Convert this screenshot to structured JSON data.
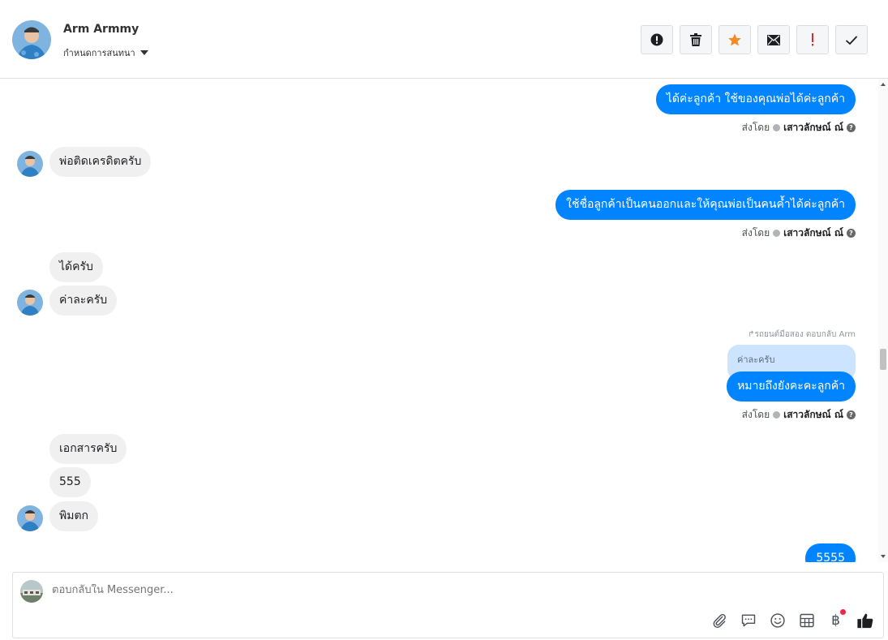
{
  "header": {
    "contact_name": "Arm Armmy",
    "subtitle": "กำหนดการสนทนา",
    "actions": [
      {
        "icon": "alert-icon",
        "name": "report-button"
      },
      {
        "icon": "trash-icon",
        "name": "delete-button"
      },
      {
        "icon": "star-icon",
        "name": "star-button",
        "color": "#f28b26"
      },
      {
        "icon": "mail-icon",
        "name": "mark-unread-button"
      },
      {
        "icon": "exclamation-icon",
        "name": "important-button",
        "color": "#e02a2a"
      },
      {
        "icon": "check-icon",
        "name": "done-button"
      }
    ]
  },
  "messages": {
    "m1": "ได้ค่ะลูกค้า ใช้ของคุณพ่อได้ค่ะลูกค้า",
    "m2": "พ่อติดเครดิตครับ",
    "m3": "ใช้ชื่อลูกค้าเป็นคนออกและให้คุณพ่อเป็นคนค้ำได้ค่ะลูกค้า",
    "m4": "ได้ครับ",
    "m5": "ค่าละครับ",
    "m6": "หมายถึงยังคะคะลูกค้า",
    "m7": "เอกสารครับ",
    "m8": "555",
    "m9": "พิมตก",
    "m10": "5555",
    "reply_hint": "รถยนต์มือสอง ตอบกลับ Arm",
    "quoted_text": "ค่าละครับ",
    "sent_by_label": "ส่งโดย",
    "sender_name": "เสาวลักษณ์ ณ์",
    "help_glyph": "?"
  },
  "composer": {
    "placeholder": "ตอบกลับใน Messenger...",
    "tools": [
      "paperclip-icon",
      "comment-icon",
      "smiley-icon",
      "table-icon",
      "baht-icon",
      "thumbs-up-icon"
    ],
    "baht_glyph": "฿"
  },
  "colors": {
    "outgoing": "#0084ff",
    "incoming": "#f1f0f0",
    "quoted": "#cce4ff",
    "star": "#f28b26",
    "alert_red": "#e02a2a",
    "notify_dot": "#f02849"
  }
}
